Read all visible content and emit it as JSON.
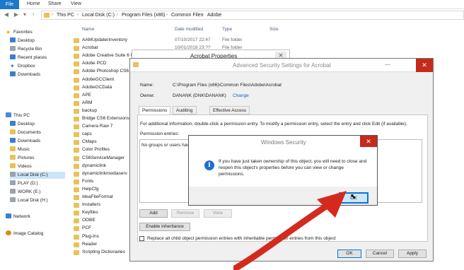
{
  "ribbon": {
    "tabs": [
      "File",
      "Home",
      "Share",
      "View"
    ]
  },
  "address": {
    "crumbs": [
      "This PC",
      "Local Disk (C:)",
      "Program Files (x86)",
      "Common Files",
      "Adobe"
    ]
  },
  "nav": {
    "favorites_label": "Favorites",
    "favorites": [
      "Desktop",
      "Recycle Bin",
      "Recent places",
      "Dropbox",
      "Downloads"
    ],
    "thispc_label": "This PC",
    "thispc": [
      "Desktop",
      "Documents",
      "Downloads",
      "Music",
      "Pictures",
      "Videos",
      "Local Disk (C:)",
      "PLAY (D:)",
      "WORK (E:)",
      "Local Disk (H:)"
    ],
    "network": "Network",
    "image_catalog": "Image Catalog"
  },
  "columns": {
    "name": "Name",
    "date": "Date modified",
    "type": "Type",
    "size": "Size"
  },
  "files": [
    {
      "name": "AAMUpdaterInventory",
      "date": "07/10/2017 22:47",
      "type": "File folder"
    },
    {
      "name": "Acrobat",
      "date": "10/01/2018 23:??",
      "type": "File folder"
    },
    {
      "name": "Adobe Creative Suite 6 Maste",
      "date": "",
      "type": ""
    },
    {
      "name": "Adobe PCD",
      "date": "",
      "type": ""
    },
    {
      "name": "Adobe Photoshop CS6",
      "date": "",
      "type": ""
    },
    {
      "name": "AdobeGCClient",
      "date": "",
      "type": ""
    },
    {
      "name": "AdobeGCData",
      "date": "",
      "type": ""
    },
    {
      "name": "APE",
      "date": "",
      "type": ""
    },
    {
      "name": "ARM",
      "date": "",
      "type": ""
    },
    {
      "name": "backup",
      "date": "",
      "type": ""
    },
    {
      "name": "Bridge CS6 Extensions",
      "date": "",
      "type": ""
    },
    {
      "name": "Camera Raw 7",
      "date": "",
      "type": ""
    },
    {
      "name": "caps",
      "date": "",
      "type": ""
    },
    {
      "name": "CMaps",
      "date": "",
      "type": ""
    },
    {
      "name": "Color Profiles",
      "date": "",
      "type": ""
    },
    {
      "name": "CS6ServiceManager",
      "date": "",
      "type": ""
    },
    {
      "name": "dynamiclink",
      "date": "",
      "type": ""
    },
    {
      "name": "dynamiclinkmediaserv",
      "date": "",
      "type": ""
    },
    {
      "name": "Fonts",
      "date": "",
      "type": ""
    },
    {
      "name": "HelpCfg",
      "date": "",
      "type": ""
    },
    {
      "name": "IdeaFileFormat",
      "date": "",
      "type": ""
    },
    {
      "name": "Installers",
      "date": "",
      "type": ""
    },
    {
      "name": "Keyfiles",
      "date": "",
      "type": ""
    },
    {
      "name": "OOBE",
      "date": "",
      "type": ""
    },
    {
      "name": "PCF",
      "date": "",
      "type": ""
    },
    {
      "name": "Plug-Ins",
      "date": "",
      "type": ""
    },
    {
      "name": "Reader",
      "date": "",
      "type": ""
    },
    {
      "name": "Scripting Dictionaries",
      "date": "",
      "type": ""
    }
  ],
  "props_dialog": {
    "title": "Acrobat Properties"
  },
  "adv_dialog": {
    "title": "Advanced Security Settings for Acrobat",
    "name_label": "Name:",
    "name_value": "C:\\Program Files (x86)\\Common Files\\Adobe\\Acrobat",
    "owner_label": "Owner:",
    "owner_value": "DANANK (DNK\\DANANK)",
    "change_link": "Change",
    "tabs": [
      "Permissions",
      "Auditing",
      "Effective Access"
    ],
    "info_text": "For additional information, double-click a permission entry. To modify a permission entry, select the entry and click Edit (if available).",
    "perm_entries_label": "Permission entries:",
    "perm_empty_text": "No groups or users hav",
    "add": "Add",
    "remove": "Remove",
    "view": "View",
    "enable_inheritance": "Enable inheritance",
    "replace_text": "Replace all child object permission entries with inheritable permission entries from this object",
    "ok": "OK",
    "cancel": "Cancel",
    "apply": "Apply"
  },
  "sec_dialog": {
    "title": "Windows Security",
    "icon": "info-icon",
    "message": "If you have just taken ownership of this object, you will need to close and reopen this object's properties before you can view or change permissions.",
    "ok": "OK"
  },
  "colors": {
    "accent": "#1979ca",
    "close_red": "#c42b1c",
    "annotation_arrow": "#d42a1e"
  }
}
